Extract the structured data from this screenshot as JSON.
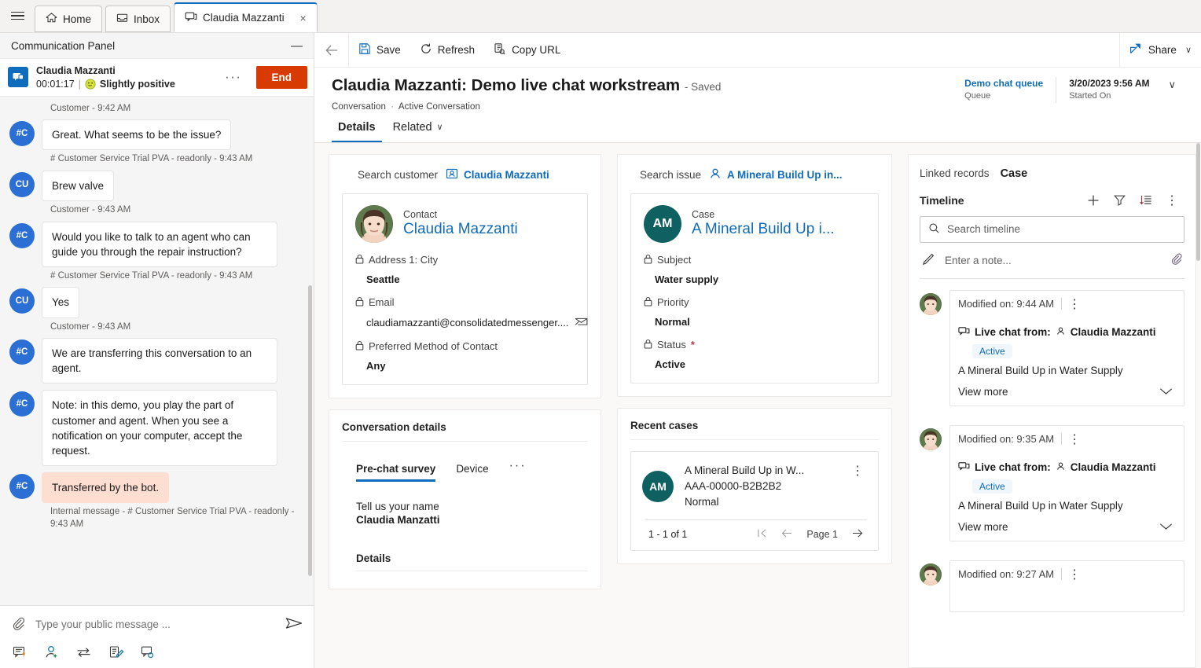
{
  "tabstrip": {
    "menu_icon": "hamburger-icon",
    "tabs": [
      {
        "label": "Home",
        "icon": "home-icon",
        "active": false
      },
      {
        "label": "Inbox",
        "icon": "inbox-icon",
        "active": false
      },
      {
        "label": "Claudia Mazzanti",
        "icon": "chat-icon",
        "active": true,
        "close": "×"
      }
    ]
  },
  "communication_panel": {
    "title": "Communication Panel",
    "minimize": "—",
    "session": {
      "name": "Claudia Mazzanti",
      "timer": "00:01:17",
      "separator": "|",
      "sentiment": "Slightly positive",
      "sentiment_icon": "slightly-positive-smiley-icon",
      "more": "···",
      "end_label": "End",
      "end_color": "#d83b01"
    },
    "messages": [
      {
        "kind": "stamp",
        "text": "Customer - 9:42 AM"
      },
      {
        "kind": "bubble",
        "avatar": "#C",
        "text": "Great. What seems to be the issue?",
        "internal": false
      },
      {
        "kind": "stamp",
        "text": "# Customer Service Trial PVA - readonly - 9:43 AM"
      },
      {
        "kind": "bubble",
        "avatar": "CU",
        "text": "Brew valve",
        "internal": false
      },
      {
        "kind": "stamp",
        "text": "Customer - 9:43 AM"
      },
      {
        "kind": "bubble",
        "avatar": "#C",
        "text": "Would you like to talk to an agent who can guide you through the repair instruction?",
        "internal": false
      },
      {
        "kind": "stamp",
        "text": "# Customer Service Trial PVA - readonly - 9:43 AM"
      },
      {
        "kind": "bubble",
        "avatar": "CU",
        "text": "Yes",
        "internal": false
      },
      {
        "kind": "stamp",
        "text": "Customer - 9:43 AM"
      },
      {
        "kind": "bubble",
        "avatar": "#C",
        "text": "We are transferring this conversation to an agent.",
        "internal": false
      },
      {
        "kind": "bubble",
        "avatar": "#C",
        "text": "Note: in this demo, you play the part of customer and agent. When you see a notification on your computer, accept the request.",
        "internal": false
      },
      {
        "kind": "bubble",
        "avatar": "#C",
        "text": "Transferred by the bot.",
        "internal": true
      },
      {
        "kind": "stamp",
        "text": "Internal message - # Customer Service Trial PVA - readonly - 9:43 AM"
      }
    ],
    "composer": {
      "attach_icon": "paperclip-icon",
      "placeholder": "Type your public message ...",
      "value": "",
      "send_icon": "send-icon",
      "tools": [
        {
          "name": "quick-replies-icon"
        },
        {
          "name": "add-user-icon"
        },
        {
          "name": "transfer-icon"
        },
        {
          "name": "notes-icon"
        },
        {
          "name": "consult-icon"
        }
      ]
    }
  },
  "command_bar": {
    "back_icon": "back-arrow-icon",
    "items": [
      {
        "label": "Save",
        "icon": "save-icon"
      },
      {
        "label": "Refresh",
        "icon": "refresh-icon"
      },
      {
        "label": "Copy URL",
        "icon": "copy-url-icon"
      }
    ],
    "share": {
      "label": "Share",
      "icon": "share-icon",
      "chevron": "∨"
    }
  },
  "record": {
    "title": "Claudia Mazzanti: Demo live chat workstream",
    "saved_state": "- Saved",
    "breadcrumb_entity": "Conversation",
    "breadcrumb_sep": "·",
    "breadcrumb_form": "Active Conversation",
    "header_fields": [
      {
        "value": "Demo chat queue",
        "label": "Queue",
        "link": true
      },
      {
        "value": "3/20/2023 9:56 AM",
        "label": "Started On",
        "link": false
      }
    ],
    "header_chevron": "∨",
    "tabs": [
      {
        "label": "Details",
        "active": true
      },
      {
        "label": "Related",
        "active": false,
        "chevron": "∨"
      }
    ]
  },
  "customer_panel": {
    "lookup_label": "Search customer",
    "lookup_value": "Claudia Mazzanti",
    "lookup_icon": "contact-card-icon",
    "entity_kind": "Contact",
    "entity_name": "Claudia Mazzanti",
    "avatar": "contact-photo",
    "fields": [
      {
        "label": "Address 1: City",
        "value": "Seattle",
        "lock": true,
        "type": "text"
      },
      {
        "label": "Email",
        "value": "claudiamazzanti@consolidatedmessenger....",
        "lock": true,
        "type": "email",
        "action_icon": "email-icon"
      },
      {
        "label": "Preferred Method of Contact",
        "value": "Any",
        "lock": true,
        "type": "text"
      }
    ]
  },
  "issue_panel": {
    "lookup_label": "Search issue",
    "lookup_value": "A Mineral Build Up in...",
    "lookup_icon": "person-icon",
    "entity_kind": "Case",
    "entity_name": "A Mineral Build Up i...",
    "entity_initials": "AM",
    "entity_color": "#0f6161",
    "fields": [
      {
        "label": "Subject",
        "value": "Water supply",
        "lock": true,
        "required": false
      },
      {
        "label": "Priority",
        "value": "Normal",
        "lock": true,
        "required": false
      },
      {
        "label": "Status",
        "value": "Active",
        "lock": true,
        "required": true
      }
    ]
  },
  "conversation_details": {
    "title": "Conversation details",
    "tabs": [
      {
        "label": "Pre-chat survey",
        "active": true
      },
      {
        "label": "Device",
        "active": false
      },
      {
        "label": "···",
        "active": false,
        "overflow": true
      }
    ],
    "survey": [
      {
        "question": "Tell us your name",
        "answer": "Claudia Manzatti"
      }
    ],
    "details_heading": "Details"
  },
  "recent_cases": {
    "title": "Recent cases",
    "rows": [
      {
        "initials": "AM",
        "color": "#0f6161",
        "title": "A Mineral Build Up in W...",
        "number": "AAA-00000-B2B2B2",
        "priority": "Normal",
        "more": "⋮"
      }
    ],
    "pager": {
      "count": "1 - 1 of 1",
      "first_icon": "first-page-icon",
      "prev_icon": "previous-page-icon",
      "page_label": "Page 1",
      "next_icon": "next-page-icon"
    }
  },
  "timeline": {
    "linked_records_label": "Linked records",
    "linked_records_value": "Case",
    "title": "Timeline",
    "actions": [
      {
        "name": "add-record-icon",
        "glyph": "+"
      },
      {
        "name": "filter-icon",
        "glyph": "filter"
      },
      {
        "name": "sort-icon",
        "glyph": "sort"
      },
      {
        "name": "more-commands-icon",
        "glyph": "⋮"
      }
    ],
    "search_placeholder": "Search timeline",
    "search_value": "",
    "search_icon": "search-icon",
    "note": {
      "icon": "pencil-icon",
      "placeholder": "Enter a note...",
      "value": "",
      "attach_icon": "paperclip-icon"
    },
    "items": [
      {
        "modified": "Modified on: 9:44 AM",
        "more": "⋮",
        "channel_icon": "live-chat-icon",
        "from_label": "Live chat from:",
        "from_person_icon": "person-icon",
        "from_person": "Claudia Mazzanti",
        "status": "Active",
        "description": "A Mineral Build Up in Water Supply",
        "view_more": "View more",
        "chevron": "∨"
      },
      {
        "modified": "Modified on: 9:35 AM",
        "more": "⋮",
        "channel_icon": "live-chat-icon",
        "from_label": "Live chat from:",
        "from_person_icon": "person-icon",
        "from_person": "Claudia Mazzanti",
        "status": "Active",
        "description": "A Mineral Build Up in Water Supply",
        "view_more": "View more",
        "chevron": "∨"
      },
      {
        "modified": "Modified on: 9:27 AM",
        "more": "⋮",
        "channel_icon": "live-chat-icon",
        "from_label": "",
        "from_person_icon": "person-icon",
        "from_person": "",
        "status": "",
        "description": "",
        "view_more": "",
        "chevron": ""
      }
    ]
  },
  "colors": {
    "accent": "#0f6cbd",
    "end_button": "#d83b01",
    "case_avatar": "#0f6161",
    "chat_avatar": "#2b6fd4",
    "internal_message": "#fdded1",
    "badge_bg": "#eff6fc"
  }
}
